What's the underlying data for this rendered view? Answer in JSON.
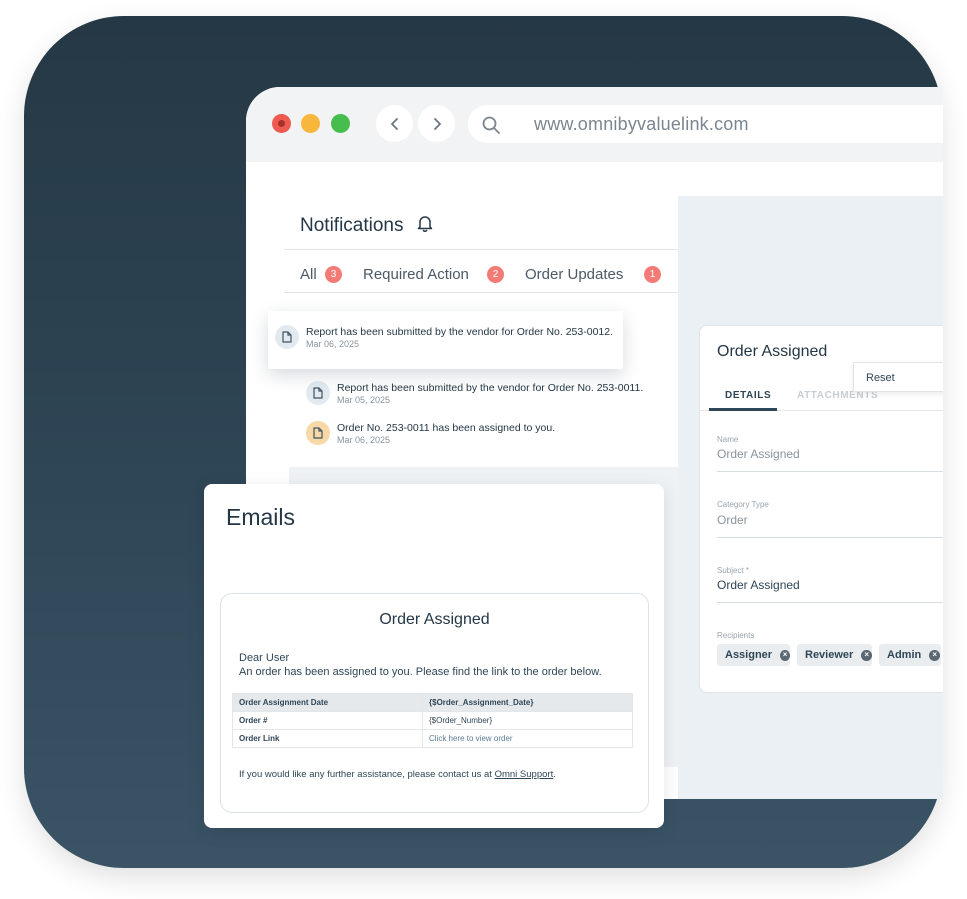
{
  "browser": {
    "url": "www.omnibyvaluelink.com"
  },
  "notifications": {
    "title": "Notifications",
    "tabs": [
      {
        "label": "All",
        "count": "3"
      },
      {
        "label": "Required Action",
        "count": "2"
      },
      {
        "label": "Order Updates",
        "count": "1"
      }
    ],
    "items": [
      {
        "message": "Report has been submitted by the vendor for Order No. 253-0012.",
        "date": "Mar 06, 2025",
        "icon": "document-icon"
      },
      {
        "message": "Report has been submitted by the vendor for Order No. 253-0011.",
        "date": "Mar 05, 2025",
        "icon": "document-icon"
      },
      {
        "message": "Order No. 253-0011 has been assigned to you.",
        "date": "Mar 06, 2025",
        "icon": "document-icon"
      }
    ]
  },
  "form": {
    "title": "Order Assigned",
    "tabs": [
      "DETAILS",
      "ATTACHMENTS"
    ],
    "reset_label": "Reset",
    "fields": [
      {
        "label": "Name",
        "value": "Order Assigned"
      },
      {
        "label": "Category Type",
        "value": "Order"
      },
      {
        "label": "Subject *",
        "value": "Order Assigned"
      }
    ],
    "recipients_label": "Recipients",
    "recipients": [
      "Assigner",
      "Reviewer",
      "Admin"
    ]
  },
  "emails": {
    "title": "Emails",
    "template": {
      "heading": "Order Assigned",
      "greeting": "Dear User",
      "body": "An order has been assigned to you. Please find the link to the order below.",
      "table": [
        {
          "key": "Order Assignment Date",
          "value": "{$Order_Assignment_Date}"
        },
        {
          "key": "Order #",
          "value": "{$Order_Number}"
        },
        {
          "key": "Order Link",
          "value": "Click here to view order"
        }
      ],
      "footer_text": "If you would like any further assistance, please contact us at",
      "footer_link": "Omni Support",
      "footer_end": "."
    }
  },
  "colors": {
    "background": "#2f4656",
    "badge": "#f37b76",
    "accent_dark": "#2f4656",
    "traffic_red": "#ee5a4f",
    "traffic_yellow": "#f6b73c",
    "traffic_green": "#46bd4d"
  }
}
